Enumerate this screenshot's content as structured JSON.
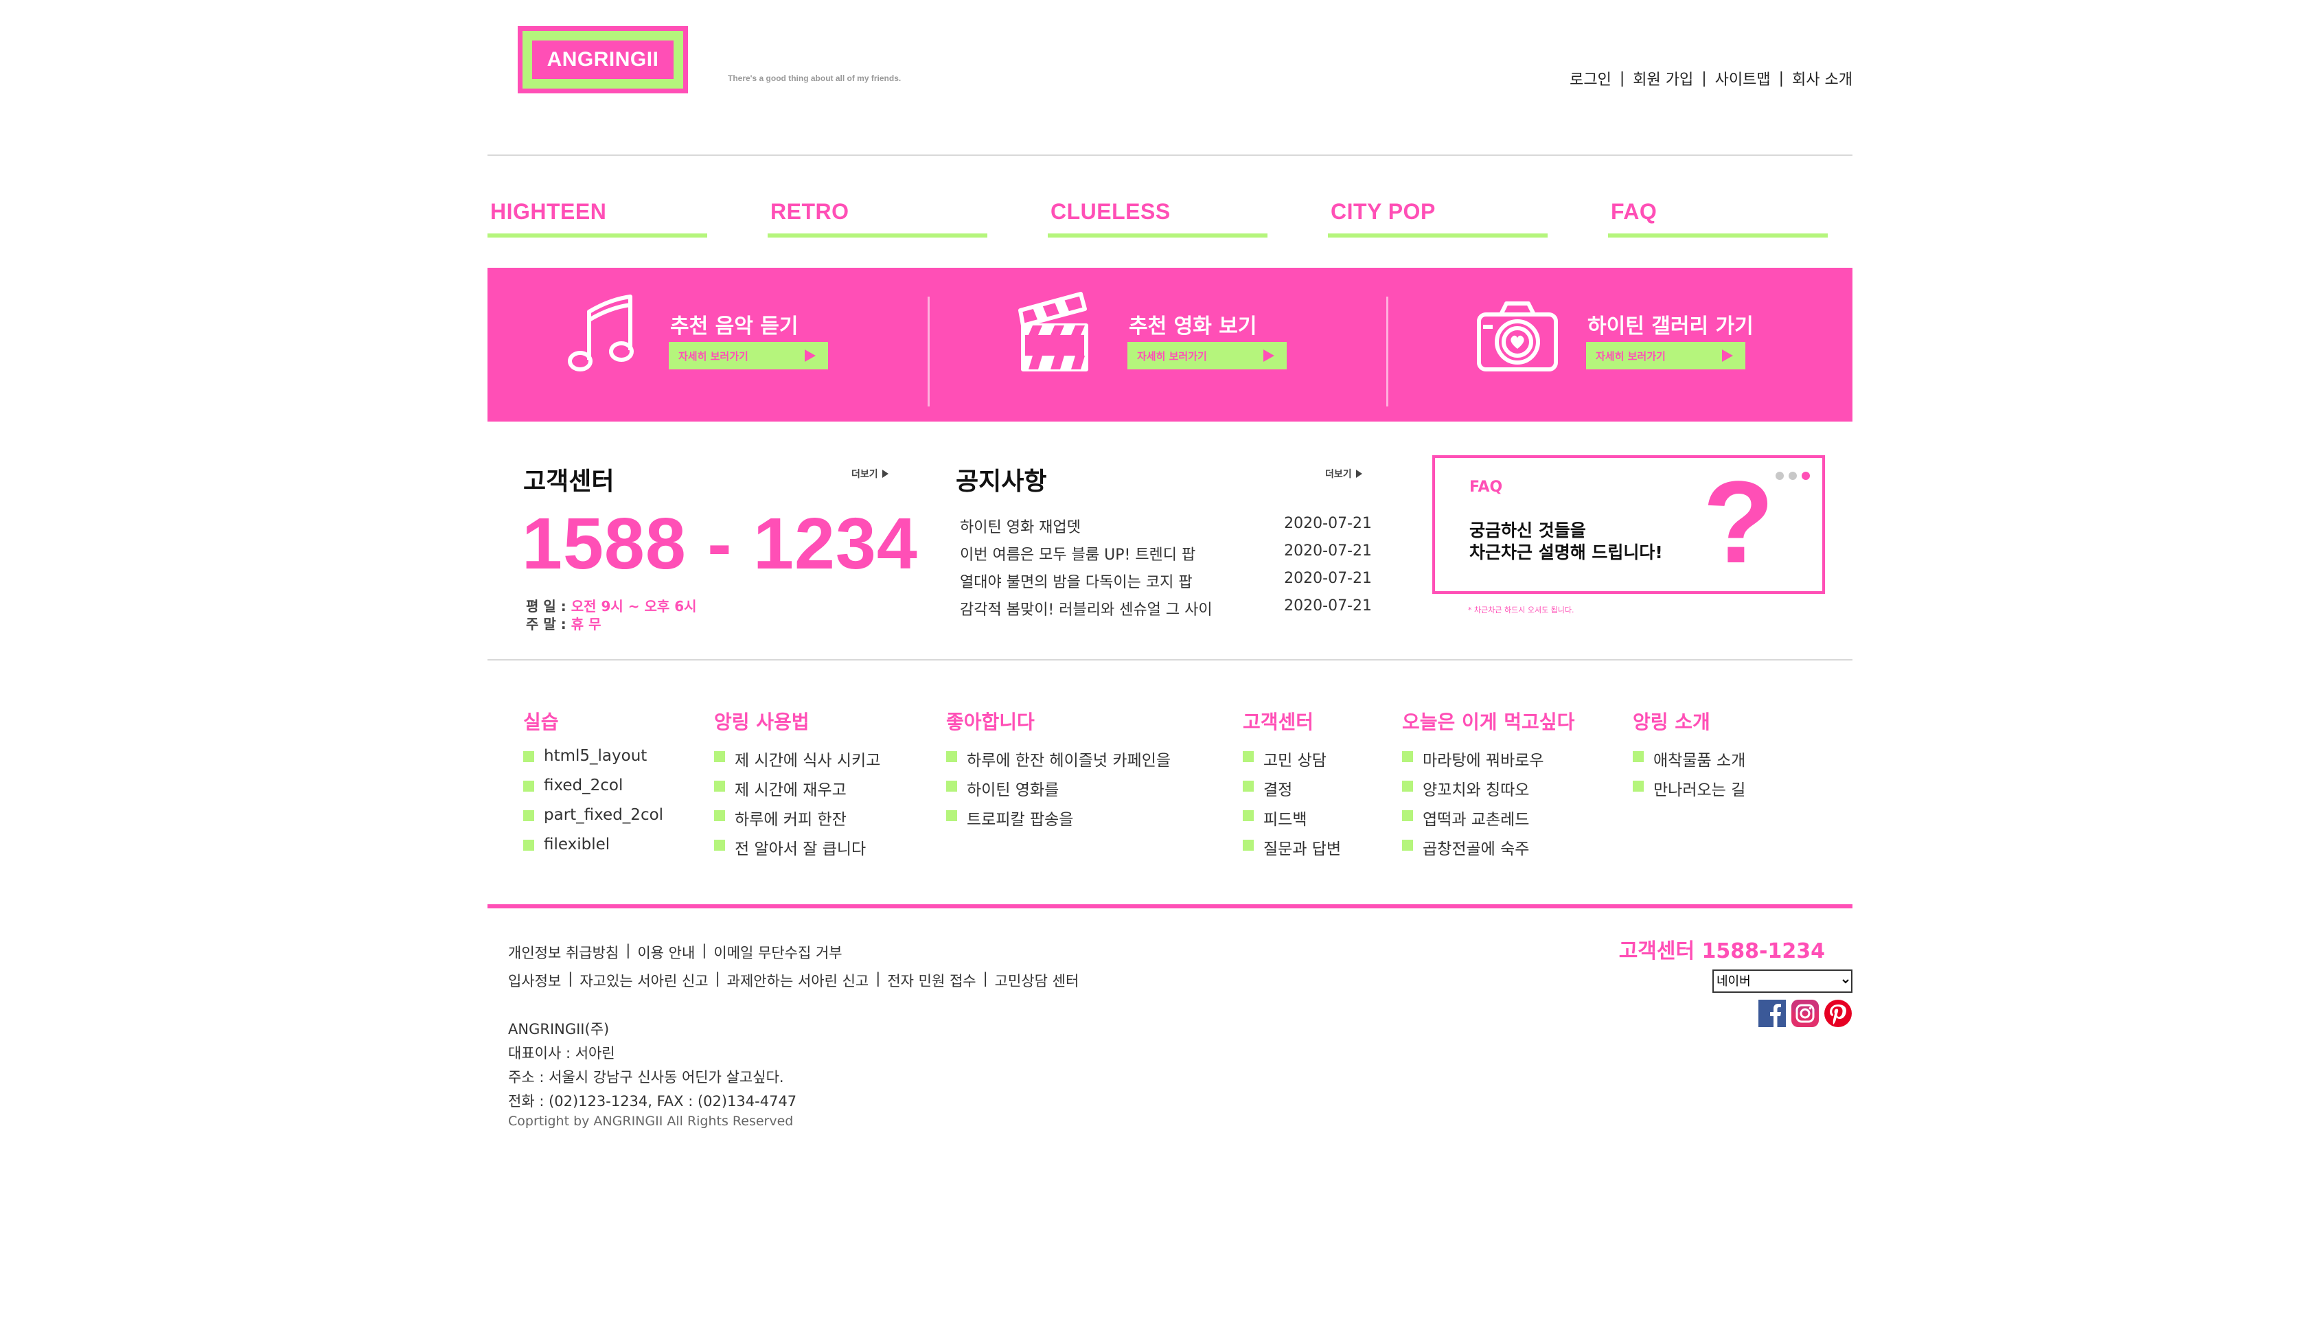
{
  "brand": {
    "logo_text": "ANGRINGII",
    "tagline": "There's a good thing about all of my friends.",
    "pink": "#ff4fb6",
    "lime": "#b5f57c"
  },
  "util_nav": [
    "로그인",
    "회원 가입",
    "사이트맵",
    "회사 소개"
  ],
  "main_nav": [
    "HIGHTEEN",
    "RETRO",
    "CLUELESS",
    "CITY POP",
    "FAQ"
  ],
  "banner": [
    {
      "title": "추천 음악 듣기",
      "button": "자세히 보러가기",
      "icon": "music-note-icon"
    },
    {
      "title": "추천 영화 보기",
      "button": "자세히 보러가기",
      "icon": "clapperboard-icon"
    },
    {
      "title": "하이틴 갤러리 가기",
      "button": "자세히 보러가기",
      "icon": "camera-icon"
    }
  ],
  "customer_center": {
    "title": "고객센터",
    "more": "더보기",
    "phone": "1588 - 1234",
    "weekday_label": "평 일 :",
    "weekday_hours": "오전 9시 ~ 오후 6시",
    "weekend_label": "주 말 :",
    "weekend_hours": "휴 무"
  },
  "notice": {
    "title": "공지사항",
    "more": "더보기",
    "items": [
      {
        "text": "하이틴 영화 재업뎃",
        "date": "2020-07-21"
      },
      {
        "text": "이번 여름은 모두 블룸 UP! 트렌디 팝",
        "date": "2020-07-21"
      },
      {
        "text": "열대야 불면의 밤을 다독이는 코지 팝",
        "date": "2020-07-21"
      },
      {
        "text": "감각적 봄맞이! 러블리와 센슈얼 그 사이",
        "date": "2020-07-21"
      }
    ]
  },
  "faq_card": {
    "label": "FAQ",
    "line1": "궁금하신 것들을",
    "line2": "차근차근 설명해 드립니다!",
    "mark": "?",
    "note": "* 차근차근 하드시 오셔도 됩니다."
  },
  "sitemap": [
    {
      "heading": "실습",
      "items": [
        "html5_layout",
        "fixed_2col",
        "part_fixed_2col",
        "filexiblel"
      ]
    },
    {
      "heading": "앙링 사용법",
      "items": [
        "제 시간에 식사 시키고",
        "제 시간에 재우고",
        "하루에 커피 한잔",
        "전 알아서 잘 큽니다"
      ]
    },
    {
      "heading": "좋아합니다",
      "items": [
        "하루에 한잔 헤이즐넛 카페인을",
        "하이틴 영화를",
        "트로피칼 팝송을"
      ]
    },
    {
      "heading": "고객센터",
      "items": [
        "고민 상담",
        "결정",
        "피드백",
        "질문과 답변"
      ]
    },
    {
      "heading": "오늘은 이게 먹고싶다",
      "items": [
        "마라탕에 꿔바로우",
        "양꼬치와 칭따오",
        "엽떡과 교촌레드",
        "곱창전골에 숙주"
      ]
    },
    {
      "heading": "앙링 소개",
      "items": [
        "애착물품 소개",
        "만나러오는 길"
      ]
    }
  ],
  "footer": {
    "links_row1": [
      "개인정보 취급방침",
      "이용 안내",
      "이메일 무단수집 거부"
    ],
    "links_row2": [
      "입사정보",
      "자고있는 서아린 신고",
      "과제안하는 서아린 신고",
      "전자 민원 접수",
      "고민상담 센터"
    ],
    "company": "ANGRINGII(주)",
    "ceo": "대표이사 : 서아린",
    "address": "주소 : 서울시 강남구  신사동 어딘가 살고싶다.",
    "contact": "전화 : (02)123-1234, FAX : (02)134-4747",
    "copyright": "Coprtight by ANGRINGII All Rights Reserved",
    "cs_phone": "고객센터 1588-1234",
    "family_select": "네이버",
    "sns": [
      "facebook-icon",
      "instagram-icon",
      "pinterest-icon"
    ]
  }
}
